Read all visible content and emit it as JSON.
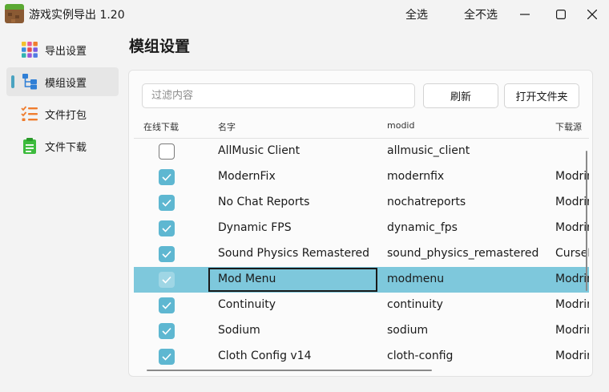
{
  "window": {
    "title": "游戏实例导出 1.20",
    "select_all": "全选",
    "select_none": "全不选"
  },
  "sidebar": {
    "items": [
      {
        "label": "导出设置",
        "icon": "grid-icon",
        "active": false
      },
      {
        "label": "模组设置",
        "icon": "hierarchy-icon",
        "active": true
      },
      {
        "label": "文件打包",
        "icon": "checklist-icon",
        "active": false
      },
      {
        "label": "文件下载",
        "icon": "clipboard-icon",
        "active": false
      }
    ]
  },
  "page": {
    "title": "模组设置",
    "filter_placeholder": "过滤内容",
    "refresh_label": "刷新",
    "open_folder_label": "打开文件夹"
  },
  "table": {
    "columns": [
      "在线下载",
      "名字",
      "modid",
      "下载源"
    ],
    "rows": [
      {
        "online": false,
        "name": "AllMusic Client",
        "modid": "allmusic_client",
        "source": ""
      },
      {
        "online": true,
        "name": "ModernFix",
        "modid": "modernfix",
        "source": "Modrinth"
      },
      {
        "online": true,
        "name": "No Chat Reports",
        "modid": "nochatreports",
        "source": "Modrinth"
      },
      {
        "online": true,
        "name": "Dynamic FPS",
        "modid": "dynamic_fps",
        "source": "Modrinth"
      },
      {
        "online": true,
        "name": "Sound Physics Remastered",
        "modid": "sound_physics_remastered",
        "source": "CurseForge"
      },
      {
        "online": true,
        "name": "Mod Menu",
        "modid": "modmenu",
        "source": "Modrinth",
        "selected": true
      },
      {
        "online": true,
        "name": "Continuity",
        "modid": "continuity",
        "source": "Modrinth"
      },
      {
        "online": true,
        "name": "Sodium",
        "modid": "sodium",
        "source": "Modrinth"
      },
      {
        "online": true,
        "name": "Cloth Config v14",
        "modid": "cloth-config",
        "source": "Modrinth"
      }
    ]
  },
  "colors": {
    "accent": "#5eb7d1",
    "selected_row": "#7ec8dc"
  }
}
